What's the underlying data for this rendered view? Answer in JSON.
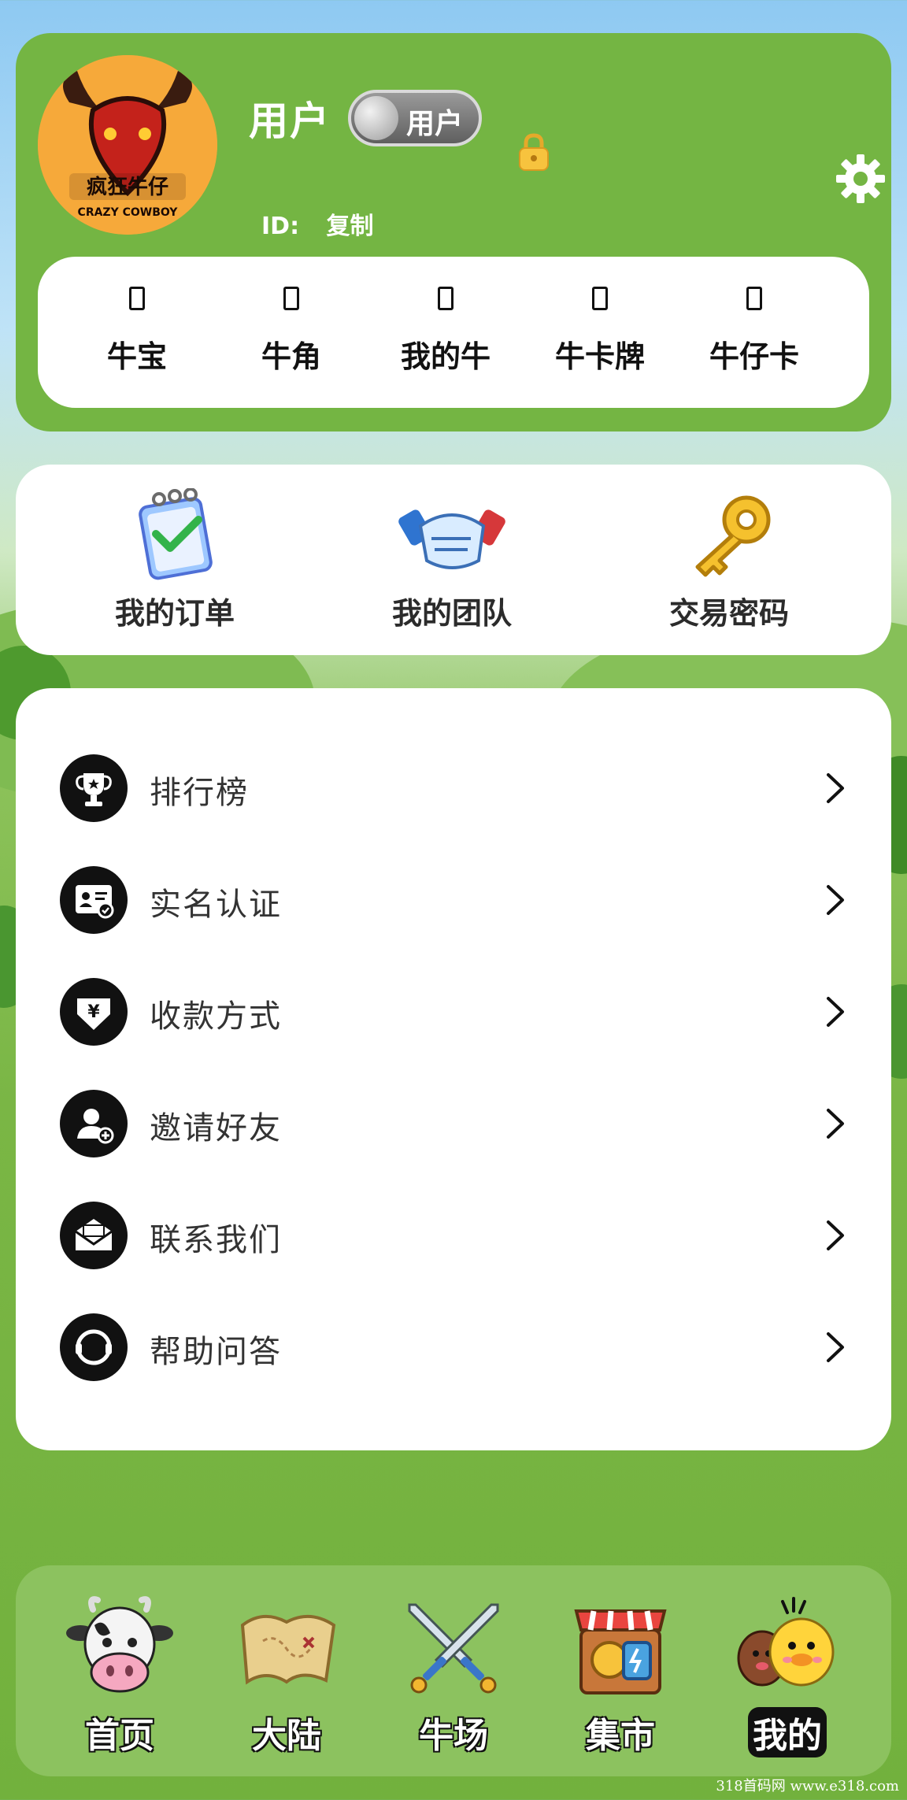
{
  "profile": {
    "name": "用户",
    "badge": "用户",
    "id_label": "ID:",
    "copy_label": "复制"
  },
  "stats": [
    {
      "label": "牛宝"
    },
    {
      "label": "牛角"
    },
    {
      "label": "我的牛"
    },
    {
      "label": "牛卡牌"
    },
    {
      "label": "牛仔卡"
    }
  ],
  "actions": [
    {
      "label": "我的订单",
      "icon": "order-icon"
    },
    {
      "label": "我的团队",
      "icon": "handshake-icon"
    },
    {
      "label": "交易密码",
      "icon": "key-icon"
    }
  ],
  "menu": [
    {
      "label": "排行榜",
      "icon": "trophy-icon"
    },
    {
      "label": "实名认证",
      "icon": "id-card-icon"
    },
    {
      "label": "收款方式",
      "icon": "yuan-download-icon"
    },
    {
      "label": "邀请好友",
      "icon": "add-user-icon"
    },
    {
      "label": "联系我们",
      "icon": "envelope-icon"
    },
    {
      "label": "帮助问答",
      "icon": "headset-icon"
    }
  ],
  "tabs": [
    {
      "label": "首页",
      "icon": "cow-icon"
    },
    {
      "label": "大陆",
      "icon": "map-icon"
    },
    {
      "label": "牛场",
      "icon": "crossed-swords-icon"
    },
    {
      "label": "集市",
      "icon": "market-stall-icon"
    },
    {
      "label": "我的",
      "icon": "duck-friends-icon",
      "active": true
    }
  ],
  "watermark": "318首码网   www.e318.com",
  "colors": {
    "card_green": "#74b543",
    "tabbar_green": "#8cc25f",
    "avatar_orange": "#f6a93a",
    "text_dark": "#333333"
  }
}
